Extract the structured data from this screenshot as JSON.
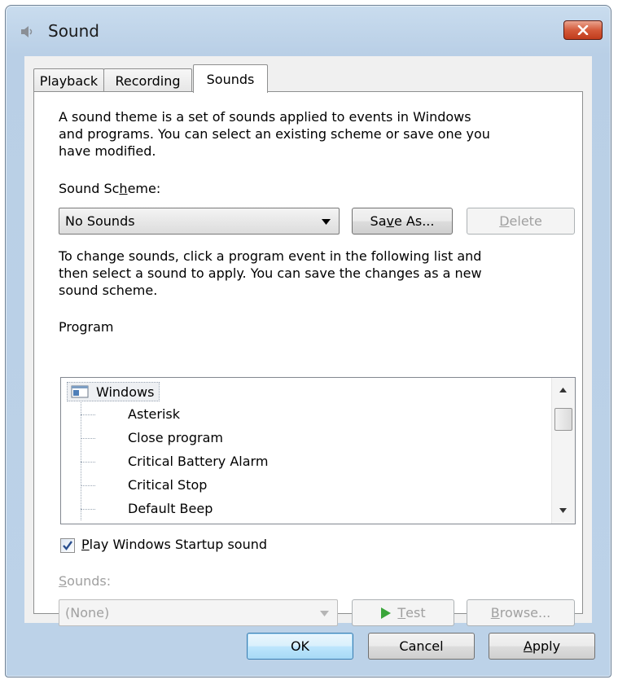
{
  "window": {
    "title": "Sound"
  },
  "tabs": [
    {
      "label": "Playback"
    },
    {
      "label": "Recording"
    },
    {
      "label": "Sounds"
    }
  ],
  "active_tab": "Sounds",
  "sounds_tab": {
    "intro_lines": [
      "A sound theme is a set of sounds applied to events in Windows",
      "and programs.  You can select an existing scheme or save one you",
      "have modified."
    ],
    "scheme_label_pre": "Sound Sc",
    "scheme_label_key": "h",
    "scheme_label_post": "eme:",
    "scheme_value": "No Sounds",
    "save_as_pre": "Sa",
    "save_as_key": "v",
    "save_as_post": "e As...",
    "delete_key": "D",
    "delete_post": "elete",
    "instructions_lines": [
      "To change sounds, click a program event in the following list and",
      "then select a sound to apply.  You can save the changes as a new",
      "sound scheme."
    ],
    "program_label": "Program",
    "program_root": "Windows",
    "program_events": [
      "Asterisk",
      "Close program",
      "Critical Battery Alarm",
      "Critical Stop",
      "Default Beep"
    ],
    "startup_checked": true,
    "startup_key": "P",
    "startup_post": "lay Windows Startup sound",
    "sounds_label_key": "S",
    "sounds_label_post": "ounds:",
    "sounds_value": "(None)",
    "test_key": "T",
    "test_post": "est",
    "browse_key": "B",
    "browse_post": "rowse..."
  },
  "footer": {
    "ok": "OK",
    "cancel": "Cancel",
    "apply_key": "A",
    "apply_post": "pply"
  },
  "colors": {
    "title_close": "#c13c1c",
    "test_play": "#3aa53a",
    "checkmark": "#2a4f8f"
  }
}
